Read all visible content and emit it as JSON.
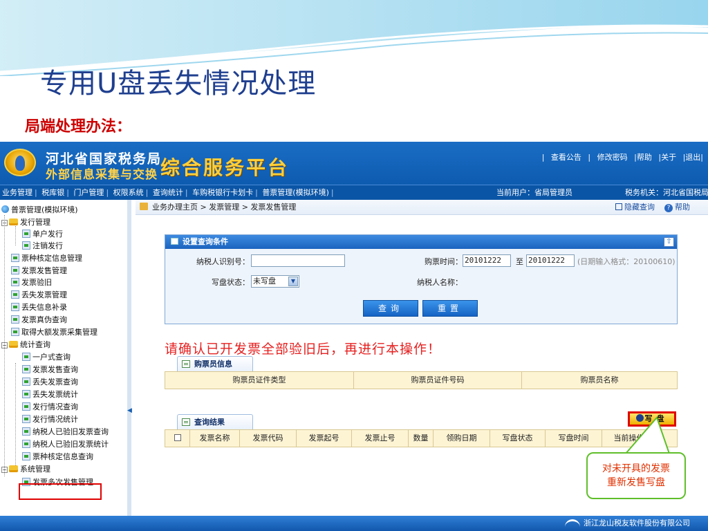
{
  "slide": {
    "title": "专用U盘丢失情况处理",
    "subtitle": "局端处理办法："
  },
  "header": {
    "org_line1": "河北省国家税务局",
    "org_line2": "外部信息采集与交换",
    "platform": "综合服务平台",
    "links": [
      "|",
      "查看公告",
      "|",
      "修改密码",
      "|帮助",
      "|关于",
      "|退出|"
    ]
  },
  "navbar": {
    "items": [
      "业务管理",
      "税库银",
      "门户管理",
      "权限系统",
      "查询统计",
      "车购税银行卡划卡",
      "普票管理(模拟环境)"
    ],
    "current_user": "当前用户：省局管理员",
    "tax_org": "税务机关：河北省国税局"
  },
  "sidebar": {
    "root": "普票管理(模拟环境)",
    "groups": [
      {
        "label": "发行管理",
        "expander": "−",
        "children": [
          "单户发行",
          "注销发行"
        ]
      },
      {
        "label": "票种核定信息管理"
      },
      {
        "label": "发票发售管理"
      },
      {
        "label": "发票验旧"
      },
      {
        "label": "丢失发票管理"
      },
      {
        "label": "丢失信息补录"
      },
      {
        "label": "发票真伪查询"
      },
      {
        "label": "取得大额发票采集管理"
      },
      {
        "label": "统计查询",
        "expander": "−",
        "children": [
          "一户式查询",
          "发票发售查询",
          "丢失发票查询",
          "丢失发票统计",
          "发行情况查询",
          "发行情况统计",
          "纳税人已验旧发票查询",
          "纳税人已验旧发票统计",
          "票种核定信息查询"
        ]
      },
      {
        "label": "系统管理",
        "expander": "−",
        "children": [
          "发票多次发售管理"
        ]
      }
    ],
    "collapse_glyph": "◀"
  },
  "breadcrumb": {
    "path": "业务办理主页 > 发票管理 > 发票发售管理",
    "hide_query": "隐藏查询",
    "help": "帮助",
    "help_glyph": "?"
  },
  "query_panel": {
    "title": "设置查询条件",
    "up_glyph": "⇧",
    "taxpayer_id_label": "纳税人识别号：",
    "taxpayer_id_value": "",
    "purchase_time_label": "购票时间：",
    "date_from": "20101222",
    "date_to_label": "至",
    "date_to": "20101222",
    "date_hint": "(日期输入格式：20100610)",
    "write_status_label": "写盘状态：",
    "write_status_value": "未写盘",
    "select_glyph": "▼",
    "taxpayer_name_label": "纳税人名称：",
    "query_button": "查询",
    "reset_button": "重置"
  },
  "warning": "请确认已开发票全部验旧后，再进行本操作！",
  "buyer_tab": {
    "title": "购票员信息",
    "columns": [
      "购票员证件类型",
      "购票员证件号码",
      "购票员名称"
    ]
  },
  "results_tab": {
    "title": "查询结果",
    "write_button": "写盘",
    "columns": [
      "发票名称",
      "发票代码",
      "发票起号",
      "发票止号",
      "数量",
      "领购日期",
      "写盘状态",
      "写盘时间",
      "当前操作员"
    ]
  },
  "callout": {
    "line1": "对未开具的发票",
    "line2": "重新发售写盘"
  },
  "footer": {
    "company": "浙江龙山税友软件股份有限公司"
  },
  "colors": {
    "banner": "#0d5bb0",
    "title_blue": "#1f3f8f",
    "warning_red": "#e62020",
    "callout_border": "#5fbf2a"
  }
}
